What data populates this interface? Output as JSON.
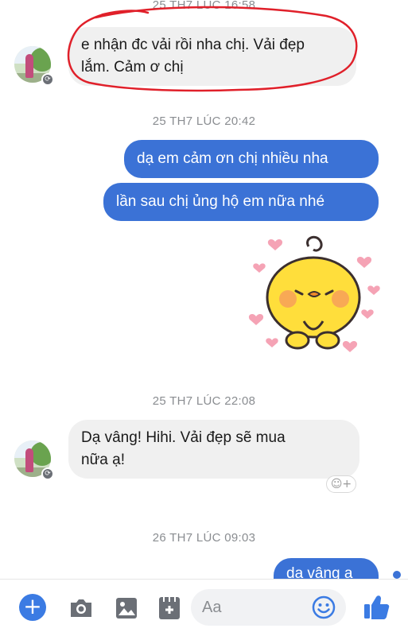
{
  "conversation": {
    "messages": [
      {
        "type": "timestamp",
        "text": "25 TH7 LÚC 16:58"
      },
      {
        "type": "incoming",
        "lines": [
          "e nhận đc vải rồi nha chị. Vải đẹp",
          "lắm. Cảm ơ chị"
        ],
        "highlighted_by_red_circle": true
      },
      {
        "type": "timestamp",
        "text": "25 TH7 LÚC 20:42"
      },
      {
        "type": "outgoing",
        "text": "dạ em cảm ơn chị nhiều nha"
      },
      {
        "type": "outgoing",
        "text": "lần sau chị ủng hộ em nữa nhé"
      },
      {
        "type": "sticker",
        "icon": "yellow-chick-hearts-sticker"
      },
      {
        "type": "timestamp",
        "text": "25 TH7 LÚC 22:08"
      },
      {
        "type": "incoming",
        "lines": [
          "Dạ vâng! Hihi. Vải đẹp sẽ mua",
          "nữa ạ!"
        ]
      },
      {
        "type": "timestamp",
        "text": "26 TH7 LÚC 09:03"
      },
      {
        "type": "outgoing",
        "text": "dạ vâng ạ",
        "partially_visible": true
      }
    ]
  },
  "composer": {
    "placeholder": "Aa"
  },
  "toolbar": {
    "icons": [
      "plus-icon",
      "camera-icon",
      "gallery-icon",
      "sticker-icon",
      "emoji-icon",
      "thumbs-up-icon"
    ]
  },
  "colors": {
    "outgoing_bubble": "#3b72d6",
    "incoming_bubble": "#f0f0f0",
    "accent": "#3b7be3",
    "annotation": "#e0202a"
  }
}
